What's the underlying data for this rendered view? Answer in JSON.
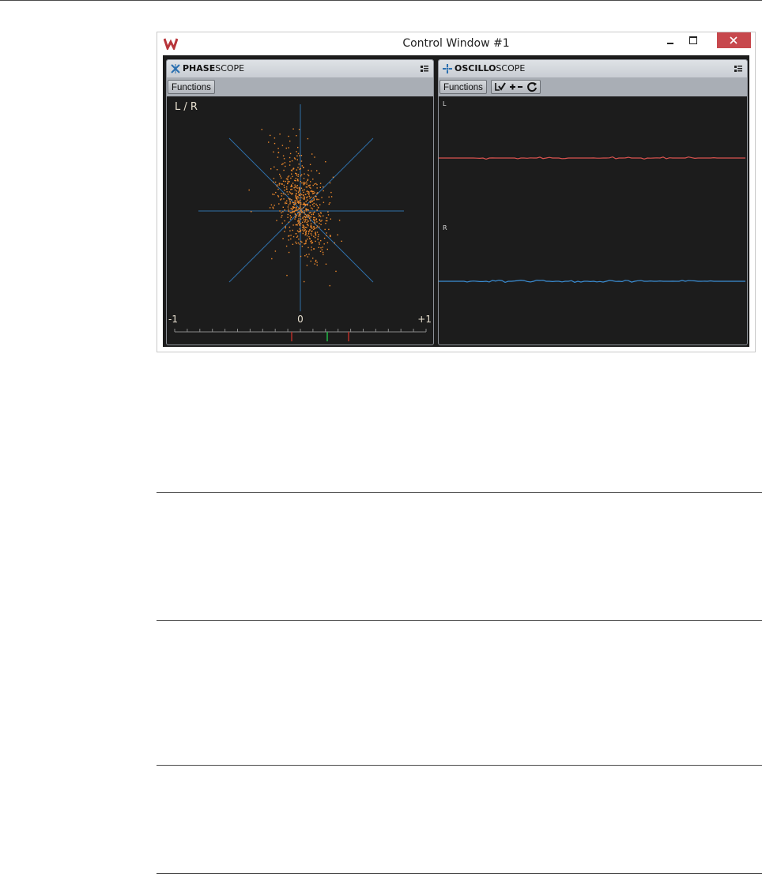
{
  "window": {
    "title": "Control Window #1",
    "close_color": "#c7484d"
  },
  "phasescope": {
    "title_bold": "PHASE",
    "title_rest": "SCOPE",
    "functions_label": "Functions",
    "mode_label": "L / R",
    "scale_left": "-1",
    "scale_center": "0",
    "scale_right": "+1",
    "colors": {
      "axes": "#2f6fa8",
      "dots": "#f08a2c",
      "marker_center": "#22c24a",
      "marker_limits": "#c0302a"
    }
  },
  "oscilloscope": {
    "title_bold": "OSCILLO",
    "title_rest": "SCOPE",
    "functions_label": "Functions",
    "channel_left": "L",
    "channel_right": "R",
    "tool_icons": [
      "auto-zoom-icon",
      "zoom-in-out-icon",
      "reset-icon"
    ],
    "colors": {
      "left_trace": "#d9534f",
      "right_trace": "#3b8fd6"
    }
  }
}
